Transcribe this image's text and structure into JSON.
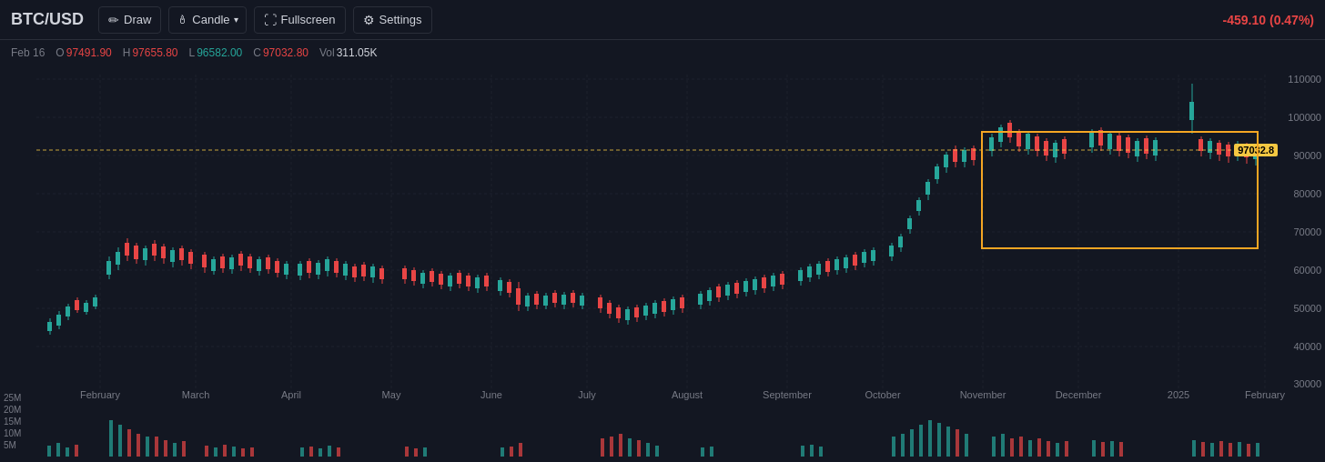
{
  "toolbar": {
    "pair": "BTC/USD",
    "draw_label": "Draw",
    "candle_label": "Candle",
    "fullscreen_label": "Fullscreen",
    "settings_label": "Settings",
    "price_change": "-459.10 (0.47%)"
  },
  "ohlc": {
    "date": "Feb 16",
    "open_label": "O",
    "open_val": "97491.90",
    "high_label": "H",
    "high_val": "97655.80",
    "low_label": "L",
    "low_val": "96582.00",
    "close_label": "C",
    "close_val": "97032.80",
    "vol_label": "Vol",
    "vol_val": "311.05K"
  },
  "chart": {
    "current_price": "97032.8",
    "y_labels": [
      "110000",
      "100000",
      "90000",
      "80000",
      "70000",
      "60000",
      "50000",
      "40000",
      "30000"
    ],
    "x_labels": [
      "February",
      "March",
      "April",
      "May",
      "June",
      "July",
      "August",
      "September",
      "October",
      "November",
      "December",
      "2025",
      "February"
    ],
    "vol_labels": [
      "25M",
      "20M",
      "15M",
      "10M",
      "5M"
    ],
    "orange_rect": {
      "label": "selection area"
    }
  }
}
